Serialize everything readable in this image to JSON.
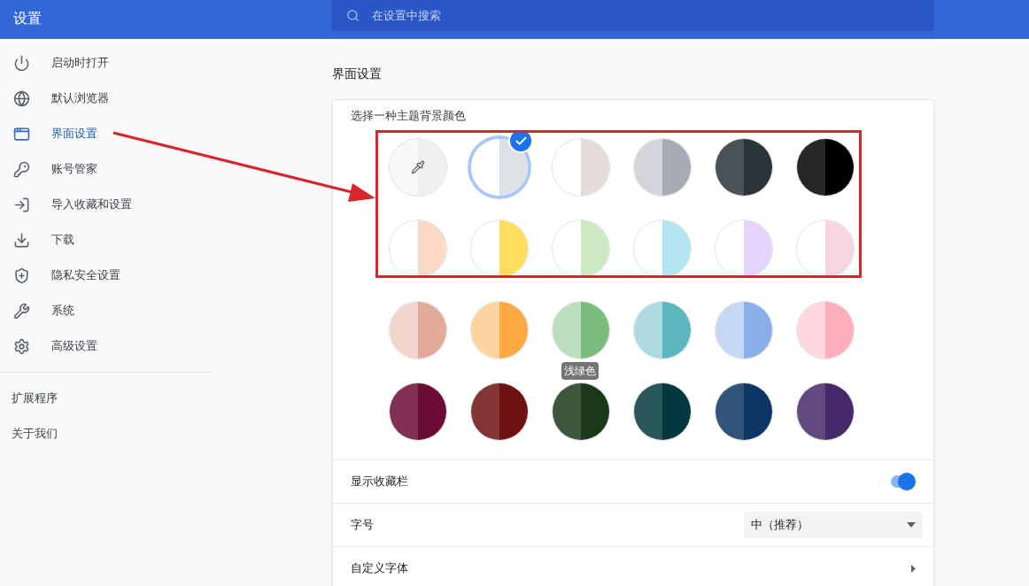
{
  "header": {
    "title": "设置",
    "search": {
      "placeholder": "在设置中搜索"
    }
  },
  "sidebar": {
    "items": [
      {
        "label": "启动时打开",
        "selected": false
      },
      {
        "label": "默认浏览器",
        "selected": false
      },
      {
        "label": "界面设置",
        "selected": true
      },
      {
        "label": "账号管家",
        "selected": false
      },
      {
        "label": "导入收藏和设置",
        "selected": false
      },
      {
        "label": "下载",
        "selected": false
      },
      {
        "label": "隐私安全设置",
        "selected": false
      },
      {
        "label": "系统",
        "selected": false
      },
      {
        "label": "高级设置",
        "selected": false
      }
    ],
    "links": [
      "扩展程序",
      "关于我们"
    ]
  },
  "section_title": "界面设置",
  "theme": {
    "label": "选择一种主题背景颜色",
    "swatches": [
      {
        "kind": "custom",
        "color": "#eff0f2",
        "selected": false
      },
      {
        "kind": "color",
        "color": "#dee1e6",
        "selected": true
      },
      {
        "kind": "color",
        "color": "#e3dcd8",
        "selected": false
      },
      {
        "kind": "color",
        "color": "#a8abb6",
        "selected": false
      },
      {
        "kind": "color",
        "color": "#29343b",
        "selected": false
      },
      {
        "kind": "color",
        "color": "#000000",
        "selected": false
      },
      {
        "kind": "color",
        "color": "#fdd9c7",
        "selected": false
      },
      {
        "kind": "color",
        "color": "#ffdd5f",
        "selected": false
      },
      {
        "kind": "color",
        "color": "#cde9c4",
        "selected": false
      },
      {
        "kind": "color",
        "color": "#b4e6f1",
        "selected": false
      },
      {
        "kind": "color",
        "color": "#e7d4fc",
        "selected": false
      },
      {
        "kind": "color",
        "color": "#f6d4e2",
        "selected": false
      },
      {
        "kind": "color",
        "color": "#e2aa98",
        "selected": false
      },
      {
        "kind": "color",
        "color": "#fda942",
        "selected": false
      },
      {
        "kind": "color",
        "color": "#7bbd7c",
        "selected": false,
        "tooltip": "浅绿色"
      },
      {
        "kind": "color",
        "color": "#5bb6c0",
        "selected": false
      },
      {
        "kind": "color",
        "color": "#89aee9",
        "selected": false
      },
      {
        "kind": "color",
        "color": "#feafbc",
        "selected": false
      },
      {
        "kind": "color",
        "color": "#6a0c34",
        "selected": false
      },
      {
        "kind": "color",
        "color": "#6e1213",
        "selected": false
      },
      {
        "kind": "color",
        "color": "#1a3919",
        "selected": false
      },
      {
        "kind": "color",
        "color": "#03393e",
        "selected": false
      },
      {
        "kind": "color",
        "color": "#0d3565",
        "selected": false
      },
      {
        "kind": "color",
        "color": "#46296a",
        "selected": false
      }
    ]
  },
  "rows": [
    {
      "kind": "toggle",
      "label": "显示收藏栏",
      "on": true
    },
    {
      "kind": "select",
      "label": "字号",
      "value": "中（推荐）"
    },
    {
      "kind": "link",
      "label": "自定义字体"
    }
  ]
}
